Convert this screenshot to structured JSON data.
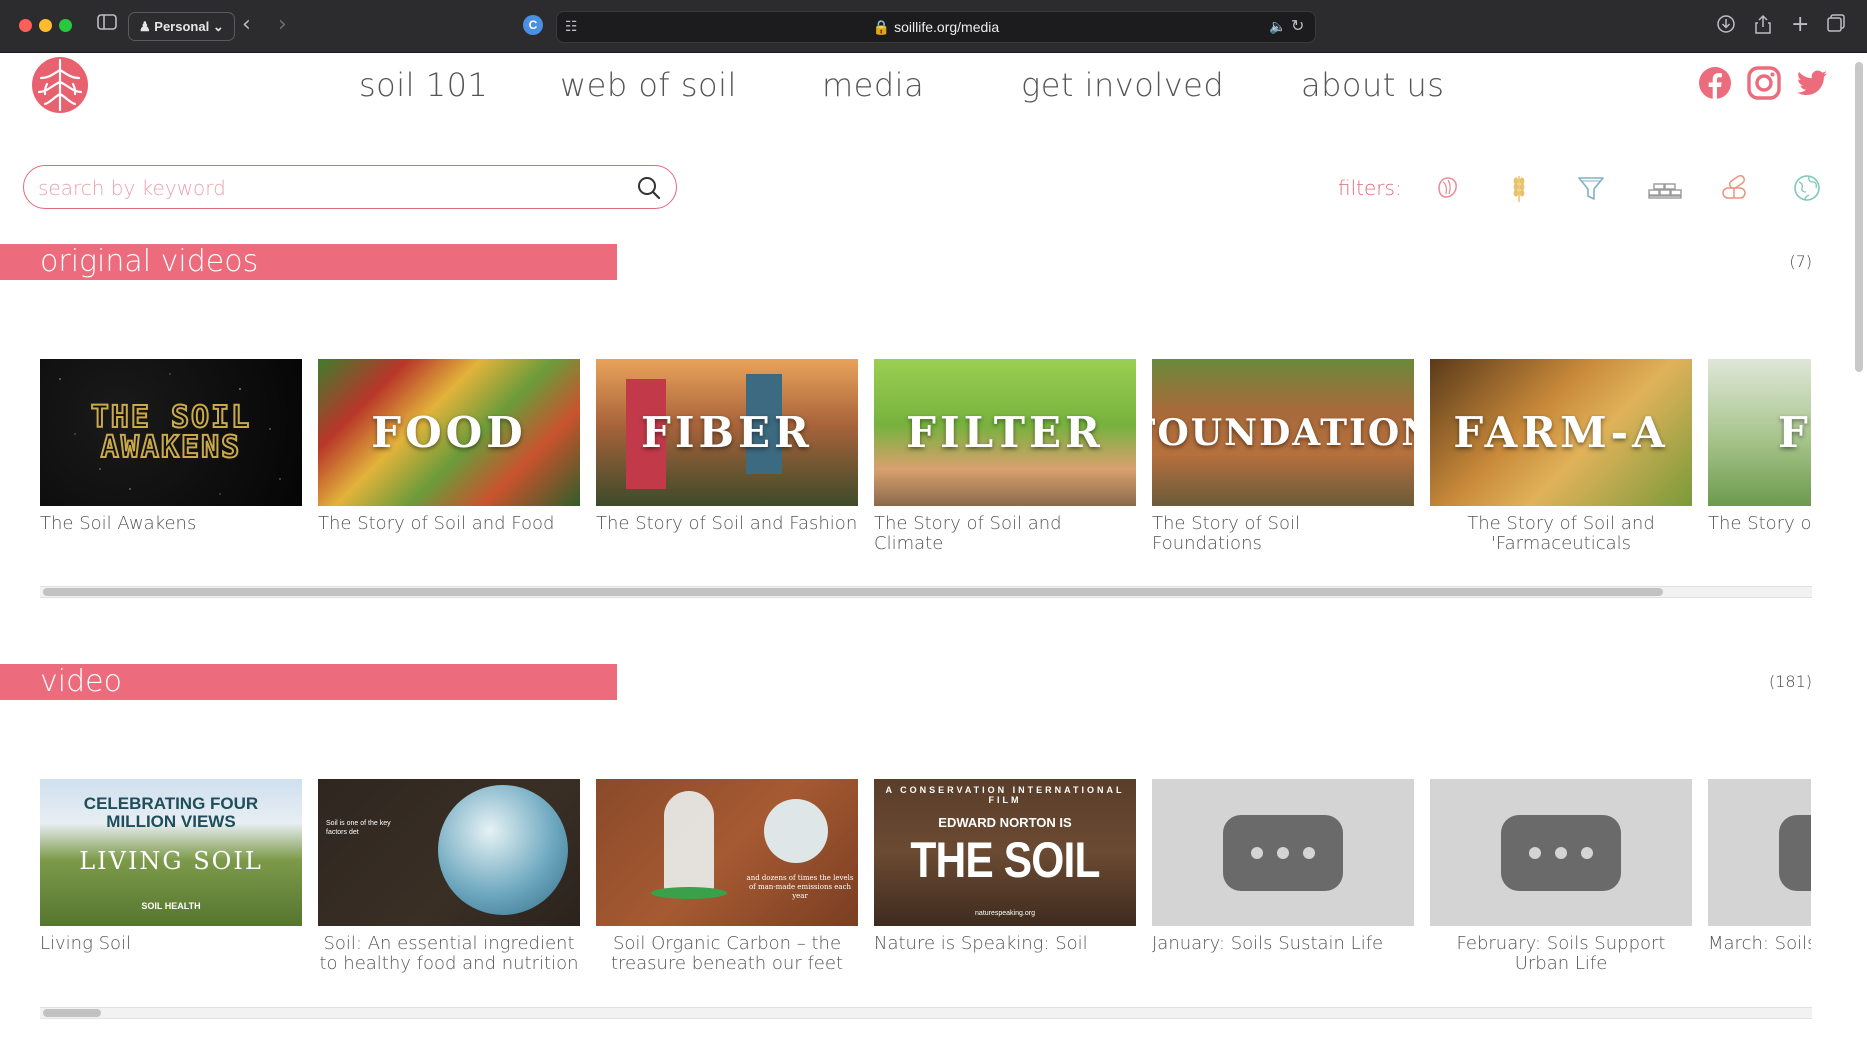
{
  "browser": {
    "profile": "Personal",
    "url": "soillife.org/media"
  },
  "nav": {
    "items": [
      "soil 101",
      "web of soil",
      "media",
      "get involved",
      "about us"
    ]
  },
  "brand_color": "#ec6b7c",
  "search": {
    "placeholder": "search by keyword"
  },
  "filters": {
    "label": "filters:",
    "icons": [
      "root-filter-icon",
      "wheat-filter-icon",
      "funnel-filter-icon",
      "bricks-filter-icon",
      "pills-filter-icon",
      "globe-filter-icon"
    ]
  },
  "sections": [
    {
      "title": "original videos",
      "count": "(7)",
      "items": [
        {
          "thumb_text": "THE SOIL AWAKENS",
          "caption": "The Soil Awakens"
        },
        {
          "thumb_text": "FOOD",
          "caption": "The Story of Soil and Food"
        },
        {
          "thumb_text": "FIBER",
          "caption": "The Story of Soil and Fashion"
        },
        {
          "thumb_text": "FILTER",
          "caption": "The Story of Soil and Climate"
        },
        {
          "thumb_text": "FOUNDATION",
          "caption": "The Story of Soil Foundations"
        },
        {
          "thumb_text": "FARM-A",
          "caption": "The Story of Soil and 'Farmaceuticals"
        },
        {
          "thumb_text": "F",
          "caption": "The Story of S"
        }
      ]
    },
    {
      "title": "video",
      "count": "(181)",
      "items": [
        {
          "thumb_text": "CELEBRATING FOUR MILLION VIEWS",
          "thumb_sub": "LIVING SOIL",
          "thumb_small": "SOIL HEALTH",
          "caption": "Living Soil"
        },
        {
          "thumb_text": "Soil is one of the key factors det",
          "caption": "Soil: An essential ingredient to healthy food and nutrition"
        },
        {
          "thumb_text": "and dozens of times the levels of man-made emissions each year",
          "caption": "Soil Organic Carbon – the treasure beneath our feet"
        },
        {
          "thumb_top": "A CONSERVATION INTERNATIONAL FILM",
          "thumb_text": "EDWARD NORTON IS",
          "thumb_big": "THE SOIL",
          "thumb_small": "naturespeaking.org",
          "caption": "Nature is Speaking: Soil"
        },
        {
          "caption": "January: Soils Sustain Life"
        },
        {
          "caption": "February: Soils Support Urban Life"
        },
        {
          "caption": "March: Soils"
        }
      ]
    }
  ]
}
